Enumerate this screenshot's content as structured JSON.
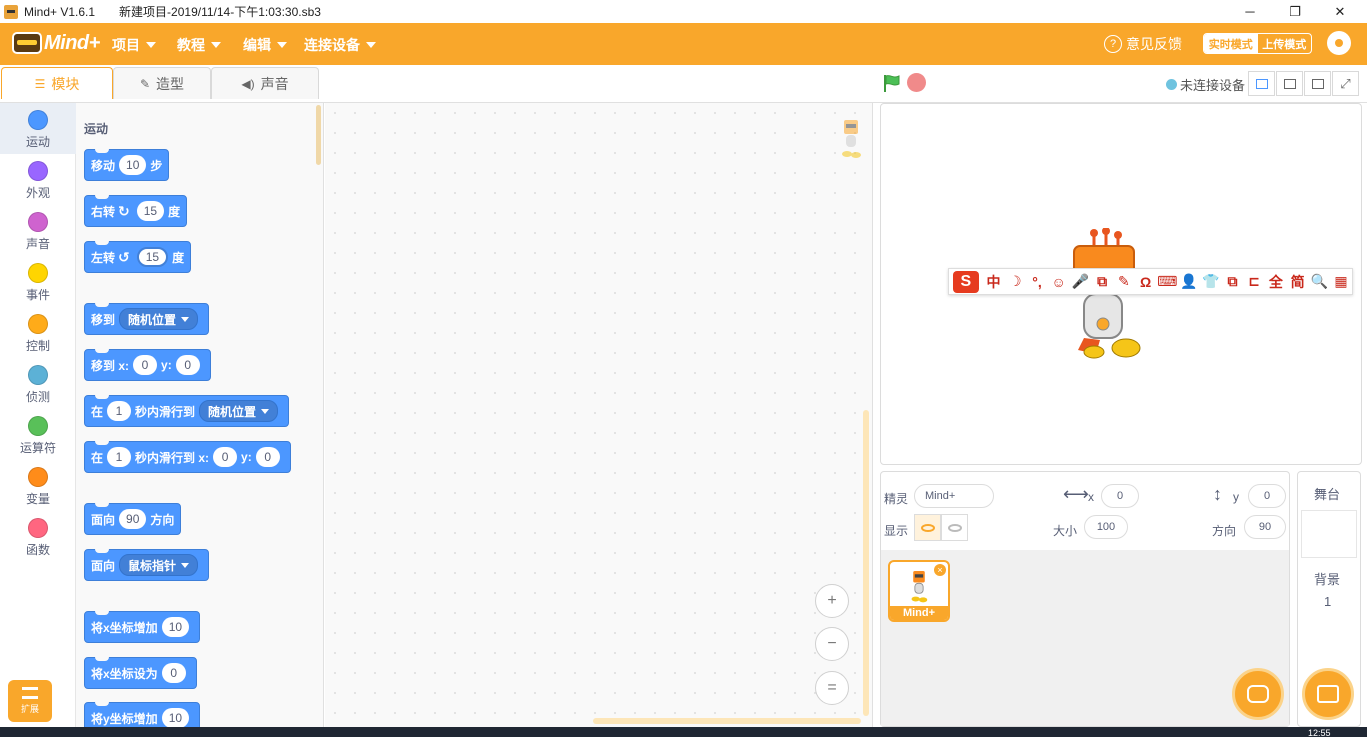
{
  "window": {
    "app_title": "Mind+ V1.6.1",
    "file_title": "新建项目-2019/11/14-下午1:03:30.sb3",
    "minimize": "─",
    "restore": "❐",
    "close": "✕"
  },
  "menubar": {
    "logo": "Mind+",
    "items": [
      {
        "label": "项目"
      },
      {
        "label": "教程"
      },
      {
        "label": "编辑"
      },
      {
        "label": "连接设备"
      }
    ],
    "feedback": "意见反馈",
    "mode_realtime": "实时模式",
    "mode_upload": "上传模式"
  },
  "tabs": [
    {
      "label": "模块"
    },
    {
      "label": "造型"
    },
    {
      "label": "声音"
    }
  ],
  "device_status": "未连接设备",
  "categories": [
    {
      "label": "运动",
      "color": "#4c97ff"
    },
    {
      "label": "外观",
      "color": "#9966ff"
    },
    {
      "label": "声音",
      "color": "#cf63cf"
    },
    {
      "label": "事件",
      "color": "#ffd500"
    },
    {
      "label": "控制",
      "color": "#ffab19"
    },
    {
      "label": "侦测",
      "color": "#5cb1d6"
    },
    {
      "label": "运算符",
      "color": "#59c059"
    },
    {
      "label": "变量",
      "color": "#ff8c1a"
    },
    {
      "label": "函数",
      "color": "#ff6680"
    }
  ],
  "extension_label": "扩展",
  "palette": {
    "section_title": "运动",
    "move": {
      "a": "移动",
      "v": "10",
      "b": "步"
    },
    "turn_right": {
      "a": "右转",
      "v": "15",
      "b": "度"
    },
    "turn_left": {
      "a": "左转",
      "v": "15",
      "b": "度"
    },
    "goto": {
      "a": "移到",
      "dd": "随机位置"
    },
    "goto_xy": {
      "a": "移到 x:",
      "x": "0",
      "b": "y:",
      "y": "0"
    },
    "glide": {
      "a": "在",
      "v": "1",
      "b": "秒内滑行到",
      "dd": "随机位置"
    },
    "glide_xy": {
      "a": "在",
      "v": "1",
      "b": "秒内滑行到 x:",
      "x": "0",
      "c": "y:",
      "y": "0"
    },
    "point_dir": {
      "a": "面向",
      "v": "90",
      "b": "方向"
    },
    "point_towards": {
      "a": "面向",
      "dd": "鼠标指针"
    },
    "change_x": {
      "a": "将x坐标增加",
      "v": "10"
    },
    "set_x": {
      "a": "将x坐标设为",
      "v": "0"
    },
    "change_y": {
      "a": "将y坐标增加",
      "v": "10"
    }
  },
  "zoom": {
    "in": "+",
    "out": "−",
    "reset": "="
  },
  "ime_glyphs": [
    "中",
    "☽",
    "°,",
    "☺",
    "🎤",
    "⧉",
    "✎",
    "Ω",
    "⌨",
    "👤",
    "👕",
    "⧉",
    "⊏",
    "全",
    "简",
    "🔍",
    "▦"
  ],
  "ime_logo": "S",
  "sprite_info": {
    "sprite_label": "精灵",
    "sprite_name": "Mind+",
    "x_label": "x",
    "x_value": "0",
    "y_label": "y",
    "y_value": "0",
    "show_label": "显示",
    "size_label": "大小",
    "size_value": "100",
    "direction_label": "方向",
    "direction_value": "90"
  },
  "sprite_tile": {
    "name": "Mind+",
    "delete": "×"
  },
  "stage_panel": {
    "title": "舞台",
    "backdrop_label": "背景",
    "backdrop_count": "1"
  },
  "taskbar_clock": "12:55"
}
